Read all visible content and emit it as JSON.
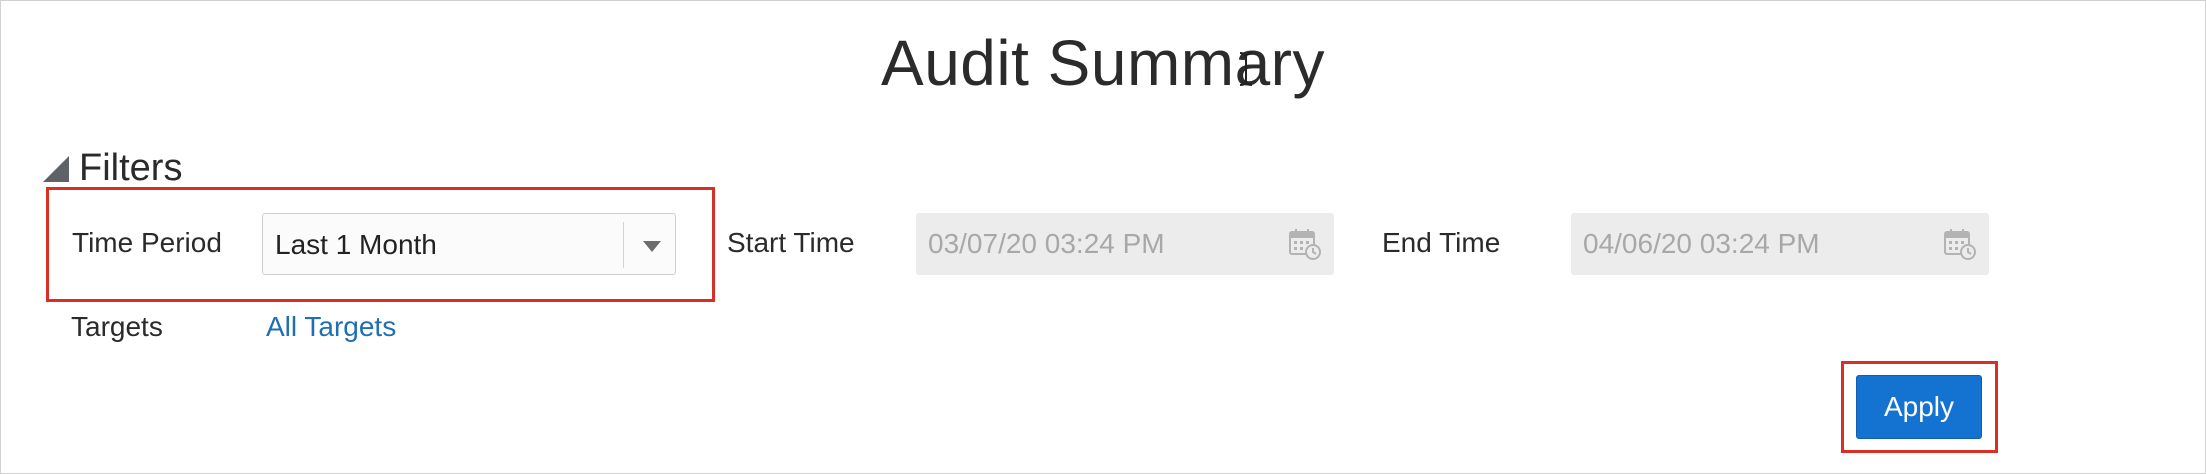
{
  "page": {
    "title": "Audit Summary"
  },
  "filters": {
    "header_label": "Filters",
    "time_period": {
      "label": "Time Period",
      "selected": "Last 1 Month"
    },
    "start_time": {
      "label": "Start Time",
      "value": "03/07/20 03:24 PM"
    },
    "end_time": {
      "label": "End Time",
      "value": "04/06/20 03:24 PM"
    },
    "targets": {
      "label": "Targets",
      "link_text": "All Targets"
    }
  },
  "actions": {
    "apply_label": "Apply"
  },
  "colors": {
    "accent": "#1473d0",
    "link": "#1f6fb2",
    "highlight": "#d93025",
    "disabled_bg": "#ececec"
  }
}
